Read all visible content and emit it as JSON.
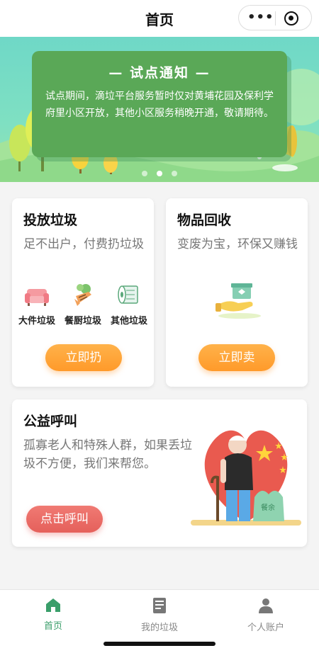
{
  "navbar": {
    "title": "首页",
    "more_icon": "more-dots-icon",
    "close_icon": "target-circle-icon"
  },
  "banner": {
    "title": "— 试点通知 —",
    "body": "试点期间，滴垃平台服务暂时仅对黄埔花园及保利学府里小区开放，其他小区服务稍晚开通，敬请期待。",
    "page_count": 3,
    "active_page": 2
  },
  "dispose_card": {
    "title": "投放垃圾",
    "desc": "足不出户，付费扔垃圾",
    "categories": [
      {
        "label": "大件垃圾",
        "icon": "sofa-icon"
      },
      {
        "label": "餐厨垃圾",
        "icon": "food-waste-icon"
      },
      {
        "label": "其他垃圾",
        "icon": "tissue-roll-icon"
      }
    ],
    "button": "立即扔"
  },
  "recycle_card": {
    "title": "物品回收",
    "desc": "变废为宝，环保又赚钱",
    "icon": "hand-box-icon",
    "button": "立即卖"
  },
  "charity_card": {
    "title": "公益呼叫",
    "desc": "孤寡老人和特殊人群，如果丢垃圾不方便，我们来帮您。",
    "illustration_bag_text": "餐余",
    "button": "点击呼叫"
  },
  "tabbar": {
    "items": [
      {
        "label": "首页",
        "icon": "home-icon",
        "active": true
      },
      {
        "label": "我的垃圾",
        "icon": "document-icon",
        "active": false
      },
      {
        "label": "个人账户",
        "icon": "user-icon",
        "active": false
      }
    ],
    "active_color": "#3a9e6a",
    "inactive_color": "#888888"
  },
  "colors": {
    "accent_orange": "#ff9a2a",
    "accent_red": "#e5605b",
    "notice_green": "#5aa857"
  }
}
